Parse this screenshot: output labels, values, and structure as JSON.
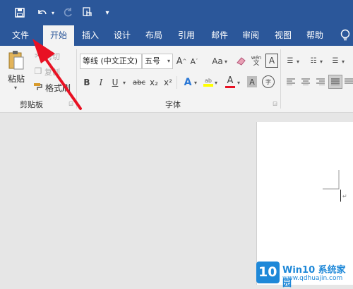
{
  "colors": {
    "accent": "#2b579a",
    "ribbon": "#f3f3f3",
    "red": "#e81123",
    "highlight": "#ffff00"
  },
  "qat": {
    "dropdown": "▾"
  },
  "tabs": [
    {
      "label": "文件"
    },
    {
      "label": "开始"
    },
    {
      "label": "插入"
    },
    {
      "label": "设计"
    },
    {
      "label": "布局"
    },
    {
      "label": "引用"
    },
    {
      "label": "邮件"
    },
    {
      "label": "审阅"
    },
    {
      "label": "视图"
    },
    {
      "label": "帮助"
    }
  ],
  "clipboard": {
    "paste": "粘贴",
    "cut": "剪切",
    "copy": "复制",
    "format_painter": "格式刷",
    "group": "剪贴板"
  },
  "font": {
    "name": "等线 (中文正文)",
    "size": "五号",
    "group": "字体",
    "grow": "A",
    "shrink": "A",
    "case": "Aa",
    "phonetic": "wén",
    "border_char": "A",
    "bold": "B",
    "italic": "I",
    "underline": "U",
    "strike": "abc",
    "sub": "x₂",
    "sup": "x²",
    "color_a": "A",
    "shade_a": "A",
    "enclose": "字"
  },
  "watermark": {
    "brand": "Win10 系统家园",
    "url": "www.qdhuajin.com",
    "number": "10"
  }
}
